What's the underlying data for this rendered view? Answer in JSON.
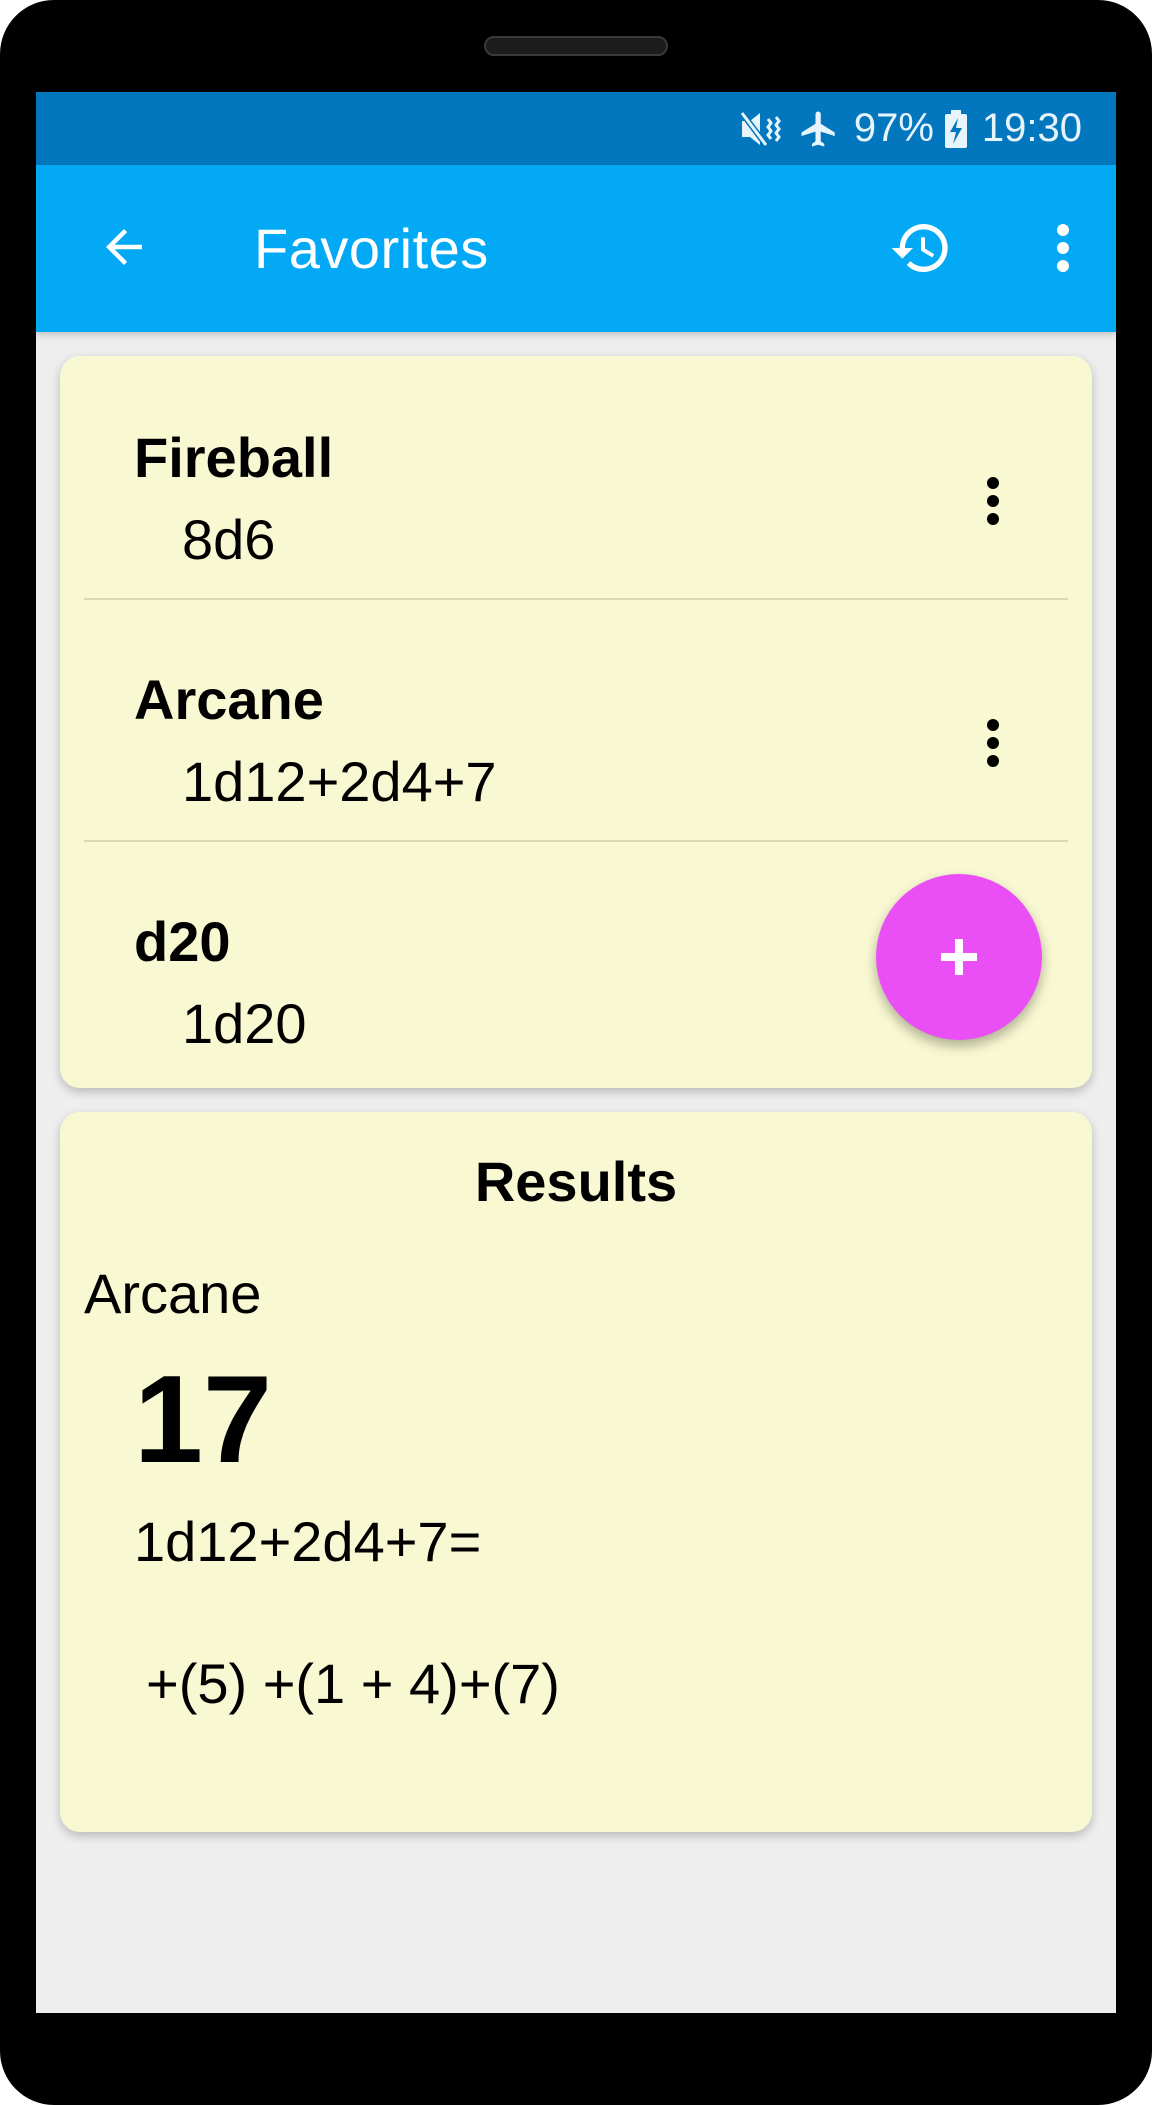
{
  "status_bar": {
    "mute_icon": "vibrate-mute-icon",
    "airplane_icon": "airplane-icon",
    "battery_percent": "97%",
    "battery_icon": "battery-charging-icon",
    "time": "19:30"
  },
  "app_bar": {
    "back_icon": "arrow-back-icon",
    "title": "Favorites",
    "history_icon": "history-icon",
    "more_icon": "more-vert-icon"
  },
  "favorites": [
    {
      "name": "Fireball",
      "formula": "8d6"
    },
    {
      "name": "Arcane",
      "formula": "1d12+2d4+7"
    },
    {
      "name": "d20",
      "formula": "1d20"
    }
  ],
  "fab": {
    "label": "+"
  },
  "results": {
    "title": "Results",
    "name": "Arcane",
    "total": "17",
    "formula": "1d12+2d4+7=",
    "breakdown": "+(5) +(1 + 4)+(7)"
  },
  "colors": {
    "status_bar": "#0277bd",
    "app_bar": "#03a9f4",
    "card": "#f8f8d2",
    "fab": "#e94ff5",
    "background": "#eeeeee"
  }
}
